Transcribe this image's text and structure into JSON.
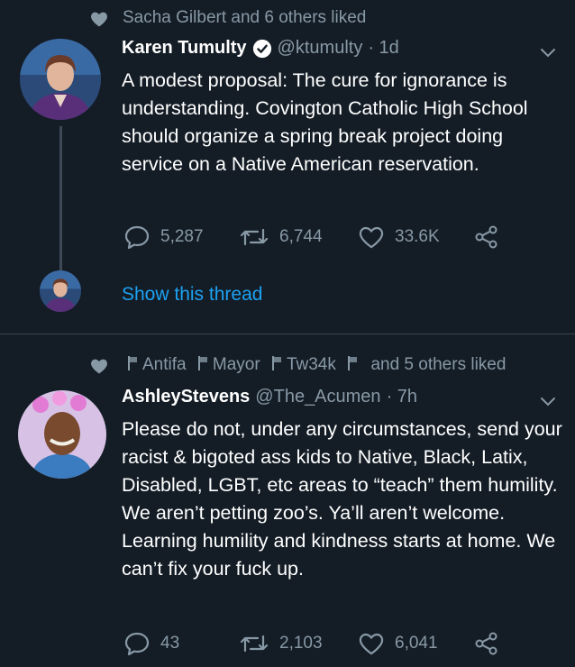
{
  "tweet1": {
    "social_context": "Sacha Gilbert and 6 others liked",
    "author_name": "Karen Tumulty",
    "handle": "@ktumulty",
    "time": "· 1d",
    "body": "A modest proposal: The cure for ignorance is understanding. Covington Catholic High School should organize a spring break project doing service on a Native American reservation.",
    "replies": "5,287",
    "retweets": "6,744",
    "likes": "33.6K",
    "show_thread": "Show this thread"
  },
  "tweet2": {
    "social_context": {
      "names": [
        "Antifa",
        "Mayor",
        "Tw34k"
      ],
      "suffix": "and 5 others liked"
    },
    "author_name": "AshleyStevens",
    "handle": "@The_Acumen",
    "time": "· 7h",
    "body": "Please do not, under any circumstances, send your racist & bigoted ass kids to Native, Black, Latix, Disabled, LGBT, etc areas to “teach” them humility. We aren’t petting zoo’s. Ya’ll aren’t welcome. Learning humility and kindness starts at home. We can’t fix your fuck up.",
    "replies": "43",
    "retweets": "2,103",
    "likes": "6,041"
  },
  "colors": {
    "background": "#141d26",
    "muted": "#8899a6",
    "link": "#1da1f2",
    "divider": "#38444d"
  }
}
